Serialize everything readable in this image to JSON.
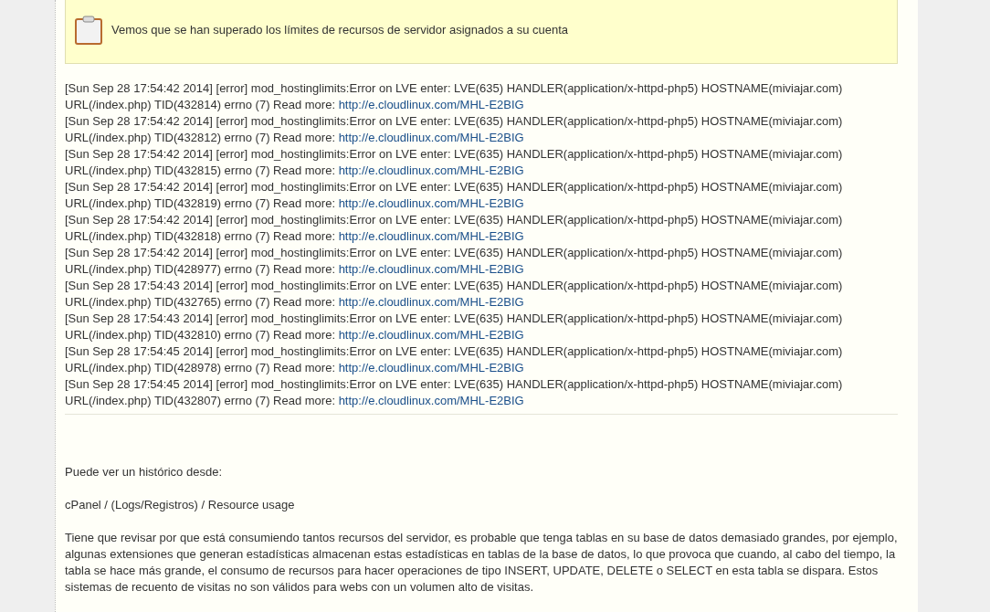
{
  "notice": {
    "text": "Vemos que se han superado los límites de recursos de servidor asignados a su cuenta"
  },
  "log_entries": [
    {
      "text": "[Sun Sep 28 17:54:42 2014] [error] mod_hostinglimits:Error on LVE enter: LVE(635) HANDLER(application/x-httpd-php5) HOSTNAME(miviajar.com) URL(/index.php) TID(432814) errno (7) Read more:",
      "link": "http://e.cloudlinux.com/MHL-E2BIG"
    },
    {
      "text": "[Sun Sep 28 17:54:42 2014] [error] mod_hostinglimits:Error on LVE enter: LVE(635) HANDLER(application/x-httpd-php5) HOSTNAME(miviajar.com) URL(/index.php) TID(432812) errno (7) Read more:",
      "link": "http://e.cloudlinux.com/MHL-E2BIG"
    },
    {
      "text": "[Sun Sep 28 17:54:42 2014] [error] mod_hostinglimits:Error on LVE enter: LVE(635) HANDLER(application/x-httpd-php5) HOSTNAME(miviajar.com) URL(/index.php) TID(432815) errno (7) Read more:",
      "link": "http://e.cloudlinux.com/MHL-E2BIG"
    },
    {
      "text": "[Sun Sep 28 17:54:42 2014] [error] mod_hostinglimits:Error on LVE enter: LVE(635) HANDLER(application/x-httpd-php5) HOSTNAME(miviajar.com) URL(/index.php) TID(432819) errno (7) Read more:",
      "link": "http://e.cloudlinux.com/MHL-E2BIG"
    },
    {
      "text": "[Sun Sep 28 17:54:42 2014] [error] mod_hostinglimits:Error on LVE enter: LVE(635) HANDLER(application/x-httpd-php5) HOSTNAME(miviajar.com) URL(/index.php) TID(432818) errno (7) Read more:",
      "link": "http://e.cloudlinux.com/MHL-E2BIG"
    },
    {
      "text": "[Sun Sep 28 17:54:42 2014] [error] mod_hostinglimits:Error on LVE enter: LVE(635) HANDLER(application/x-httpd-php5) HOSTNAME(miviajar.com) URL(/index.php) TID(428977) errno (7) Read more:",
      "link": "http://e.cloudlinux.com/MHL-E2BIG"
    },
    {
      "text": "[Sun Sep 28 17:54:43 2014] [error] mod_hostinglimits:Error on LVE enter: LVE(635) HANDLER(application/x-httpd-php5) HOSTNAME(miviajar.com) URL(/index.php) TID(432765) errno (7) Read more:",
      "link": "http://e.cloudlinux.com/MHL-E2BIG"
    },
    {
      "text": "[Sun Sep 28 17:54:43 2014] [error] mod_hostinglimits:Error on LVE enter: LVE(635) HANDLER(application/x-httpd-php5) HOSTNAME(miviajar.com) URL(/index.php) TID(432810) errno (7) Read more:",
      "link": "http://e.cloudlinux.com/MHL-E2BIG"
    },
    {
      "text": "[Sun Sep 28 17:54:45 2014] [error] mod_hostinglimits:Error on LVE enter: LVE(635) HANDLER(application/x-httpd-php5) HOSTNAME(miviajar.com) URL(/index.php) TID(428978) errno (7) Read more:",
      "link": "http://e.cloudlinux.com/MHL-E2BIG"
    },
    {
      "text": "[Sun Sep 28 17:54:45 2014] [error] mod_hostinglimits:Error on LVE enter: LVE(635) HANDLER(application/x-httpd-php5) HOSTNAME(miviajar.com) URL(/index.php) TID(432807) errno (7) Read more:",
      "link": "http://e.cloudlinux.com/MHL-E2BIG"
    }
  ],
  "paragraphs": [
    "Puede ver un histórico desde:",
    "cPanel / (Logs/Registros) / Resource usage",
    "Tiene que revisar por que está consumiendo tantos recursos del servidor, es probable que tenga tablas en su base de datos demasiado grandes, por ejemplo, algunas extensiones que generan estadísticas almacenan estas estadísticas en tablas de la base de datos, lo que provoca que cuando, al cabo del tiempo, la tabla se hace más grande, el consumo de recursos para hacer operaciones de tipo INSERT, UPDATE, DELETE o SELECT en esta tabla se dispara. Estos sistemas de recuento de visitas no son válidos para webs con un volumen alto de visitas."
  ]
}
